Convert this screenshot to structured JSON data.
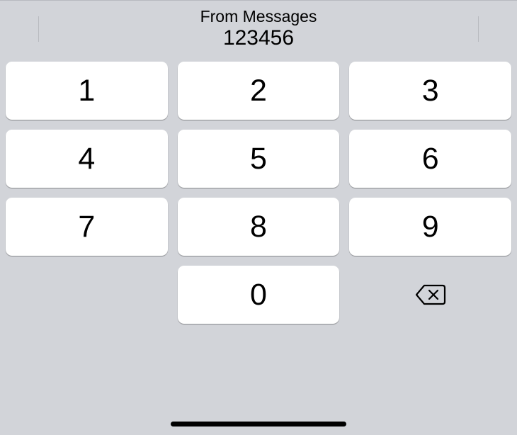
{
  "suggestion": {
    "title": "From Messages",
    "value": "123456"
  },
  "keypad": {
    "keys": [
      "1",
      "2",
      "3",
      "4",
      "5",
      "6",
      "7",
      "8",
      "9",
      "0"
    ]
  }
}
